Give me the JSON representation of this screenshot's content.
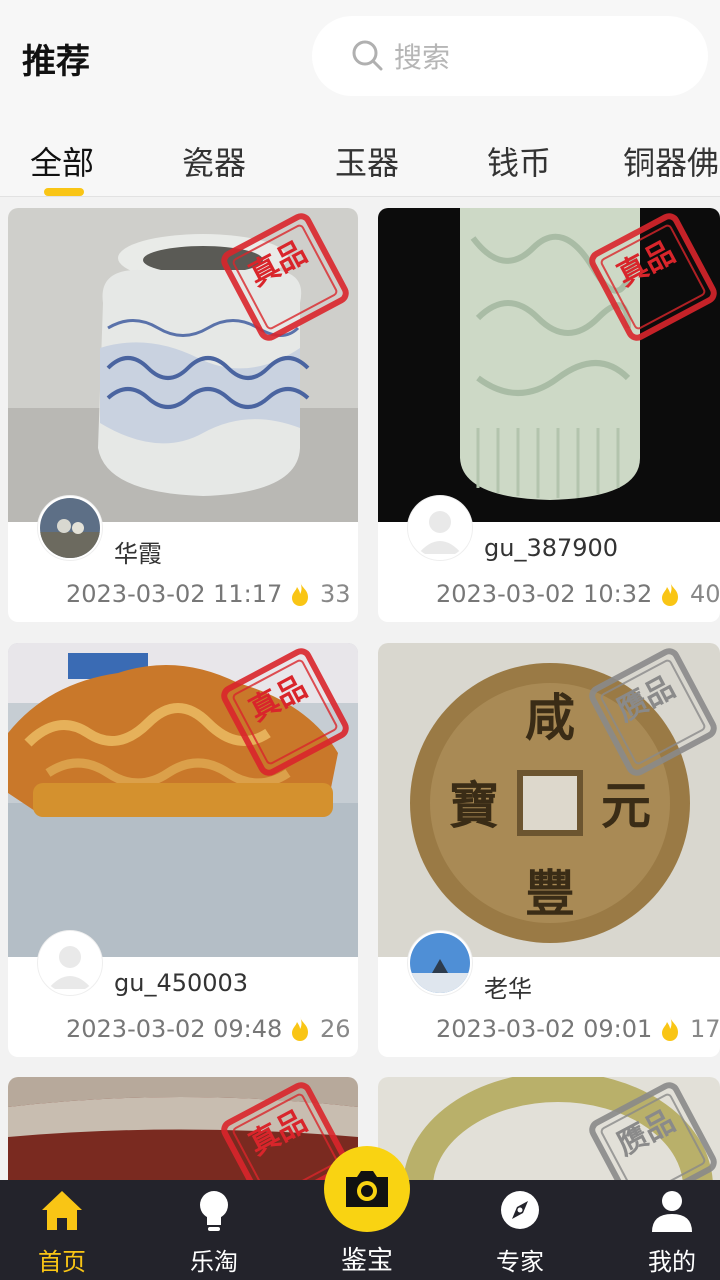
{
  "header": {
    "title": "推荐",
    "search_placeholder": "搜索"
  },
  "tabs": [
    {
      "label": "全部",
      "active": true
    },
    {
      "label": "瓷器",
      "active": false
    },
    {
      "label": "玉器",
      "active": false
    },
    {
      "label": "钱币",
      "active": false
    },
    {
      "label": "铜器佛",
      "active": false
    }
  ],
  "cards": [
    {
      "user": "华霞",
      "time": "2023-03-02 11:17",
      "hot": "33",
      "stamp": "真品",
      "subject": "blue-and-white porcelain jar"
    },
    {
      "user": "gu_387900",
      "time": "2023-03-02 10:32",
      "hot": "40",
      "stamp": "真品",
      "subject": "celadon carved vase"
    },
    {
      "user": "gu_450003",
      "time": "2023-03-02 09:48",
      "hot": "26",
      "stamp": "真品",
      "subject": "amber carving"
    },
    {
      "user": "老华",
      "time": "2023-03-02 09:01",
      "hot": "17",
      "stamp": "赝品",
      "subject": "bronze coin"
    },
    {
      "stamp": "真品",
      "subject": "partial item"
    },
    {
      "stamp": "赝品",
      "subject": "jade bangle"
    }
  ],
  "coin": {
    "top": "咸",
    "right": "元",
    "bottom": "豐",
    "left": "寶"
  },
  "bottom_nav": [
    {
      "label": "首页",
      "icon": "home-icon",
      "active": true
    },
    {
      "label": "乐淘",
      "icon": "lightbulb-icon",
      "active": false
    },
    {
      "label": "鉴宝",
      "icon": "camera-icon",
      "active": false
    },
    {
      "label": "专家",
      "icon": "compass-icon",
      "active": false
    },
    {
      "label": "我的",
      "icon": "user-icon",
      "active": false
    }
  ],
  "colors": {
    "accent": "#f9c515",
    "nav_bg": "#23232b",
    "stamp_red": "#d9252b",
    "stamp_gray": "#8a8a8a"
  }
}
